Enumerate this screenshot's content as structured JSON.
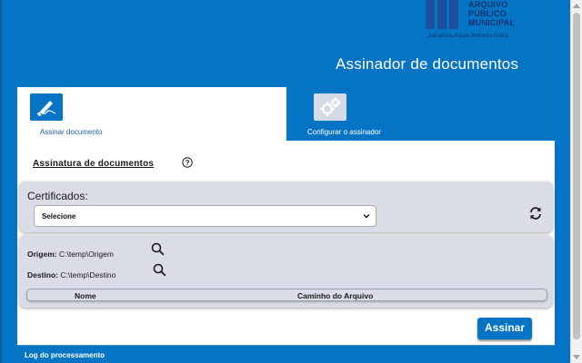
{
  "logo": {
    "lines": [
      "ARQUIVO",
      "PÚBLICO",
      "MUNICIPAL"
    ],
    "subtitle": "Jornalista Paulo Roberto Dutra"
  },
  "header": {
    "title": "Assinador de documentos"
  },
  "tabs": [
    {
      "label": "Assinar documento",
      "icon": "signature-icon",
      "active": true
    },
    {
      "label": "Configurar o assinador",
      "icon": "gears-icon",
      "active": false
    }
  ],
  "section": {
    "title": "Assinatura de documentos",
    "help_icon": "question-icon"
  },
  "certificates": {
    "label": "Certificados:",
    "selected": "Selecione",
    "refresh_icon": "refresh-icon"
  },
  "paths": {
    "origem_label": "Origem:",
    "origem_value": "C:\\temp\\Origem",
    "destino_label": "Destino:",
    "destino_value": "C:\\temp\\Destino"
  },
  "file_table": {
    "columns": [
      "Nome",
      "Caminho do Arquivo"
    ]
  },
  "actions": {
    "sign_label": "Assinar"
  },
  "log": {
    "label": "Log do processamento"
  },
  "colors": {
    "primary": "#0674c4",
    "panel": "#dadce8",
    "logo": "#1b4f9e"
  }
}
